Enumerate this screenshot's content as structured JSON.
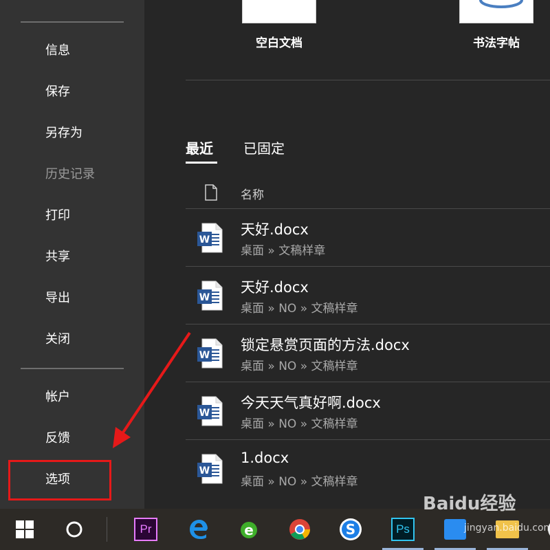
{
  "sidebar": {
    "items": [
      {
        "label": "信息"
      },
      {
        "label": "保存"
      },
      {
        "label": "另存为"
      },
      {
        "label": "历史记录"
      },
      {
        "label": "打印"
      },
      {
        "label": "共享"
      },
      {
        "label": "导出"
      },
      {
        "label": "关闭"
      },
      {
        "label": "帐户"
      },
      {
        "label": "反馈"
      },
      {
        "label": "选项"
      }
    ]
  },
  "templates": [
    {
      "label": "空白文档"
    },
    {
      "label": "书法字帖"
    }
  ],
  "tabs": [
    {
      "label": "最近",
      "active": true
    },
    {
      "label": "已固定",
      "active": false
    }
  ],
  "file_list": {
    "column_header": "名称",
    "files": [
      {
        "name": "天好.docx",
        "path": "桌面 » 文稿样章"
      },
      {
        "name": "天好.docx",
        "path": "桌面 » NO » 文稿样章"
      },
      {
        "name": "锁定悬赏页面的方法.docx",
        "path": "桌面 » NO » 文稿样章"
      },
      {
        "name": "今天天气真好啊.docx",
        "path": "桌面 » NO » 文稿样章"
      },
      {
        "name": "1.docx",
        "path": "桌面 » NO » 文稿样章"
      }
    ]
  },
  "annotation": {
    "color": "#e61919"
  },
  "taskbar": {
    "apps": [
      "windows-start-icon",
      "cortana-icon",
      "premiere-pro-icon",
      "edge-icon",
      "ie-icon",
      "chrome-icon",
      "sogou-icon",
      "photoshop-icon",
      "app-icon",
      "folder-icon"
    ],
    "pr_label": "Pr",
    "ps_label": "Ps"
  },
  "watermark": {
    "text": "Baidu经验",
    "sub": "jingyan.baidu.com"
  }
}
